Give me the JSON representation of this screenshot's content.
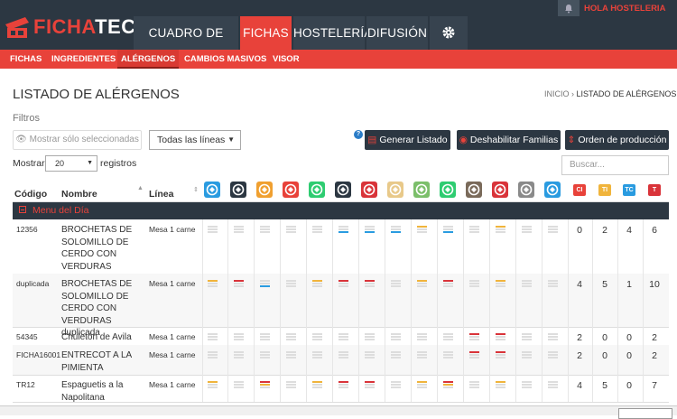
{
  "app": {
    "logo_left": "FICHA",
    "logo_right": "TEC",
    "greeting": "HOLA HOSTELERIA"
  },
  "main_tabs": [
    {
      "label": "CUADRO DE MANDO"
    },
    {
      "label": "FICHAS"
    },
    {
      "label": "HOSTELERÍA"
    },
    {
      "label": "DIFUSIÓN"
    }
  ],
  "sub_tabs": [
    {
      "label": "FICHAS"
    },
    {
      "label": "INGREDIENTES"
    },
    {
      "label": "ALÉRGENOS"
    },
    {
      "label": "CAMBIOS MASIVOS"
    },
    {
      "label": "VISOR"
    }
  ],
  "page": {
    "title": "LISTADO DE ALÉRGENOS",
    "crumb_home": "INICIO",
    "crumb_current": "LISTADO DE ALÉRGENOS",
    "filters_label": "Filtros",
    "show_selected": "Mostrar sólo seleccionadas",
    "lines_select": "Todas las líneas",
    "help": "?"
  },
  "actions": {
    "generate": "Generar Listado",
    "disable": "Deshabilitar Familias",
    "production": "Orden de producción"
  },
  "table_ctrl": {
    "show": "Mostrar",
    "len": "20",
    "records": "registros",
    "search_placeholder": "Buscar..."
  },
  "columns": {
    "code": "Código",
    "name": "Nombre",
    "line": "Línea"
  },
  "totals_headers": [
    {
      "label": "CI",
      "color": "#e8423a"
    },
    {
      "label": "TI",
      "color": "#f0b43c"
    },
    {
      "label": "TC",
      "color": "#2a9be0"
    },
    {
      "label": "T",
      "color": "#d9343a"
    }
  ],
  "allergen_icons": [
    {
      "name": "gluten-icon",
      "color": "#2a9be0"
    },
    {
      "name": "crustaceans-icon",
      "color": "#2c3742"
    },
    {
      "name": "eggs-icon",
      "color": "#f0a030"
    },
    {
      "name": "fish-icon",
      "color": "#e8423a"
    },
    {
      "name": "peanuts-icon",
      "color": "#2ecc71"
    },
    {
      "name": "soy-icon",
      "color": "#2c3742"
    },
    {
      "name": "milk-icon",
      "color": "#d9343a"
    },
    {
      "name": "nuts-icon",
      "color": "#e8c98a"
    },
    {
      "name": "celery-icon",
      "color": "#7cbf6b"
    },
    {
      "name": "mustard-icon",
      "color": "#2ecc71"
    },
    {
      "name": "sesame-icon",
      "color": "#7a6a5a"
    },
    {
      "name": "sulphites-icon",
      "color": "#d9343a"
    },
    {
      "name": "lupin-icon",
      "color": "#8a8a8a"
    },
    {
      "name": "molluscs-icon",
      "color": "#2a9be0"
    }
  ],
  "group": {
    "label": "Menu del Día"
  },
  "rows": [
    {
      "code": "12356",
      "name": [
        "BROCHETAS DE",
        "SOLOMILLO DE",
        "CERDO CON",
        "VERDURAS"
      ],
      "line": "Mesa 1 carne",
      "marks": [
        "n",
        "n",
        "n",
        "n",
        "n",
        "b",
        "b",
        "b",
        "y",
        "b",
        "n",
        "y",
        "n",
        "n"
      ],
      "totals": [
        "0",
        "2",
        "4",
        "6"
      ]
    },
    {
      "code": "duplicada",
      "name": [
        "BROCHETAS DE",
        "SOLOMILLO DE",
        "CERDO CON",
        "VERDURAS duplicada"
      ],
      "line": "Mesa 1 carne",
      "marks": [
        "y",
        "r",
        "b",
        "n",
        "y",
        "r",
        "r",
        "n",
        "y",
        "r",
        "n",
        "y",
        "n",
        "n"
      ],
      "totals": [
        "4",
        "5",
        "1",
        "10"
      ]
    },
    {
      "code": "54345",
      "name": [
        "Chuletón de Avila"
      ],
      "line": "Mesa 1 carne",
      "marks": [
        "n",
        "n",
        "n",
        "n",
        "n",
        "n",
        "n",
        "n",
        "n",
        "n",
        "r",
        "r",
        "n",
        "n"
      ],
      "totals": [
        "2",
        "0",
        "0",
        "2"
      ]
    },
    {
      "code": "FICHA16001",
      "name": [
        "ENTRECOT A LA",
        "PIMIENTA"
      ],
      "line": "Mesa 1 carne",
      "marks": [
        "n",
        "n",
        "n",
        "n",
        "n",
        "n",
        "n",
        "n",
        "n",
        "n",
        "r",
        "r",
        "n",
        "n"
      ],
      "totals": [
        "2",
        "0",
        "0",
        "2"
      ]
    },
    {
      "code": "TR12",
      "name": [
        "Espaguetis a la",
        "Napolitana"
      ],
      "line": "Mesa 1 carne",
      "marks": [
        "y",
        "n",
        "ry",
        "n",
        "y",
        "r",
        "r",
        "n",
        "y",
        "ry",
        "n",
        "y",
        "n",
        "n"
      ],
      "totals": [
        "4",
        "5",
        "0",
        "7"
      ]
    }
  ]
}
